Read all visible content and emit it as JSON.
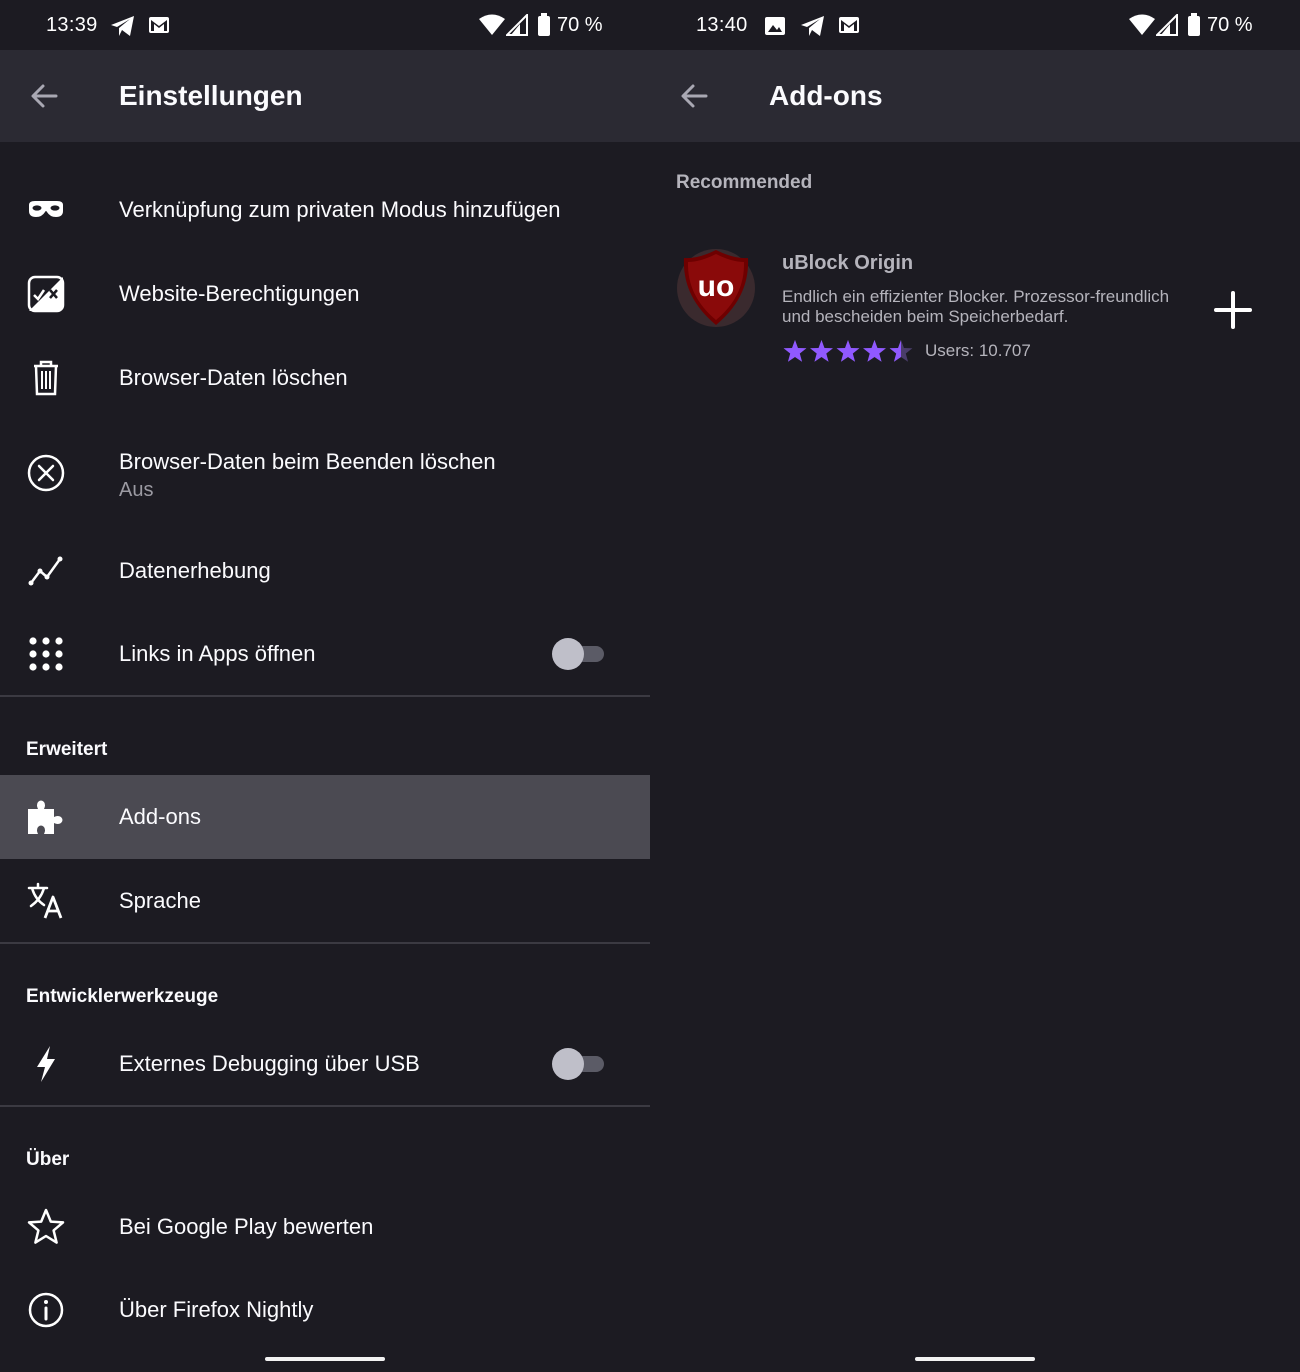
{
  "left": {
    "status": {
      "time": "13:39",
      "battery": "70 %",
      "icons": [
        "telegram-icon",
        "gmail-icon",
        "wifi-icon",
        "signal-icon",
        "battery-icon"
      ]
    },
    "appbar": {
      "title": "Einstellungen",
      "back_icon": "back-arrow-icon"
    },
    "items": [
      {
        "label": "Verknüpfung zum privaten Modus hinzufügen",
        "icon": "private-mask-icon"
      },
      {
        "label": "Website-Berechtigungen",
        "icon": "permissions-icon"
      },
      {
        "label": "Browser-Daten löschen",
        "icon": "trash-icon"
      },
      {
        "label": "Browser-Daten beim Beenden löschen",
        "sub": "Aus",
        "icon": "circle-x-icon"
      },
      {
        "label": "Datenerhebung",
        "icon": "data-graph-icon"
      },
      {
        "label": "Links in Apps öffnen",
        "icon": "apps-grid-icon",
        "toggle": false
      }
    ],
    "section_advanced": "Erweitert",
    "advanced_items": [
      {
        "label": "Add-ons",
        "icon": "puzzle-icon",
        "selected": true
      },
      {
        "label": "Sprache",
        "icon": "translate-icon"
      }
    ],
    "section_dev": "Entwicklerwerkzeuge",
    "dev_items": [
      {
        "label": "Externes Debugging über USB",
        "icon": "lightning-icon",
        "toggle": false
      }
    ],
    "section_about": "Über",
    "about_items": [
      {
        "label": "Bei Google Play bewerten",
        "icon": "star-icon"
      },
      {
        "label": "Über Firefox Nightly",
        "icon": "info-icon"
      }
    ]
  },
  "right": {
    "status": {
      "time": "13:40",
      "battery": "70 %",
      "icons": [
        "image-icon",
        "telegram-icon",
        "gmail-icon",
        "wifi-icon",
        "signal-icon",
        "battery-icon"
      ]
    },
    "appbar": {
      "title": "Add-ons",
      "back_icon": "back-arrow-icon"
    },
    "recommended_heading": "Recommended",
    "addon": {
      "name": "uBlock Origin",
      "logo_text": "uo",
      "description": "Endlich ein effizienter Blocker. Prozessor-freundlich und bescheiden beim Speicherbedarf.",
      "rating": 4.5,
      "users": "Users: 10.707",
      "add_icon": "plus-icon"
    }
  },
  "colors": {
    "background": "#1c1b22",
    "appbar": "#2b2a33",
    "selected_row": "#4b4a52",
    "star": "#9059ff",
    "ublock_red": "#800000"
  }
}
